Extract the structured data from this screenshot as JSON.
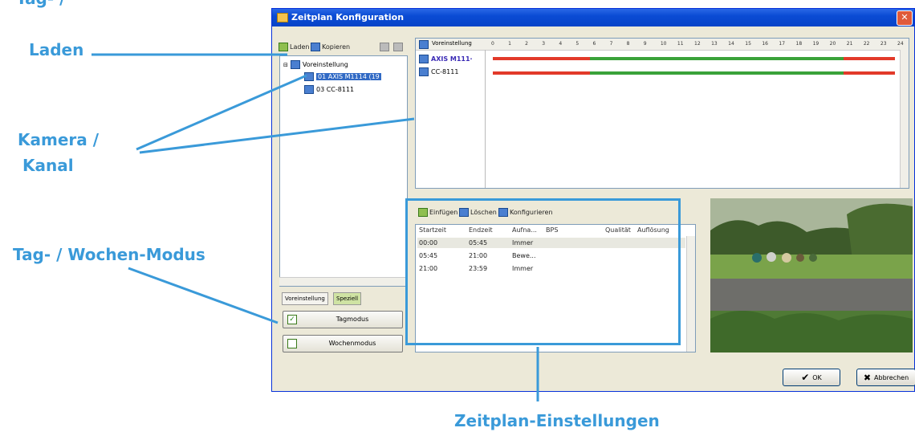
{
  "callouts": {
    "laden": "Laden",
    "kamera": "Kamera /",
    "kanal": "Kanal",
    "modus": "Tag- / Wochen-Modus",
    "zeitplan": "Zeitplan-Einstellungen",
    "top_partial": "Tag- /"
  },
  "window": {
    "title": "Zeitplan Konfiguration",
    "toolbar": {
      "load": "Laden",
      "copy": "Kopieren"
    },
    "tree": {
      "root": "Voreinstellung",
      "items": [
        "01 AXIS M1114 (19",
        "03 CC-8111"
      ]
    },
    "tabs": [
      "Voreinstellung",
      "Speziell"
    ],
    "modes": {
      "day": "Tagmodus",
      "week": "Wochenmodus"
    },
    "schedule": {
      "header_label": "Voreinstellung",
      "hours": [
        "0",
        "1",
        "2",
        "3",
        "4",
        "5",
        "6",
        "7",
        "8",
        "9",
        "10",
        "11",
        "12",
        "13",
        "14",
        "15",
        "16",
        "17",
        "18",
        "19",
        "20",
        "21",
        "22",
        "23",
        "24"
      ],
      "cameras": [
        "AXIS M111·",
        "CC-8111"
      ]
    },
    "entries_toolbar": {
      "insert": "Einfügen",
      "delete": "Löschen",
      "configure": "Konfigurieren"
    },
    "entries": {
      "columns": [
        "Startzeit",
        "Endzeit",
        "Aufna...",
        "BPS",
        "Qualität",
        "Auflösung"
      ],
      "rows": [
        [
          "00:00",
          "05:45",
          "Immer"
        ],
        [
          "05:45",
          "21:00",
          "Bewe..."
        ],
        [
          "21:00",
          "23:59",
          "Immer"
        ]
      ]
    },
    "buttons": {
      "ok": "OK",
      "cancel": "Abbrechen"
    }
  },
  "colors": {
    "accent": "#3a9ad9",
    "record_always": "#e23a2a",
    "record_motion": "#3aa23a"
  }
}
